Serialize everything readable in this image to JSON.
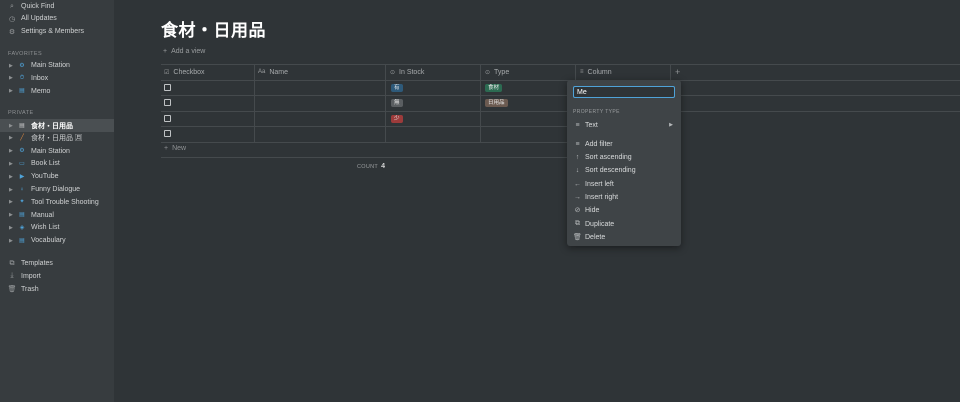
{
  "sidebar": {
    "top": [
      {
        "label": "Quick Find",
        "icon": "search-icon",
        "glyph": "⌕"
      },
      {
        "label": "All Updates",
        "icon": "clock-icon",
        "glyph": "◷"
      },
      {
        "label": "Settings & Members",
        "icon": "gear-icon",
        "glyph": "⚙"
      }
    ],
    "favorites_heading": "FAVORITES",
    "favorites": [
      {
        "label": "Main Station",
        "icon": "station-icon",
        "glyph": "⚙",
        "color": "#4fa3d9"
      },
      {
        "label": "Inbox",
        "icon": "inbox-icon",
        "glyph": "⏱",
        "color": "#4fa3d9"
      },
      {
        "label": "Memo",
        "icon": "memo-icon",
        "glyph": "▤",
        "color": "#4fa3d9"
      }
    ],
    "private_heading": "PRIVATE",
    "private": [
      {
        "label": "食材・日用品",
        "icon": "page-icon",
        "glyph": "▤",
        "color": "#c9cbcc",
        "active": true
      },
      {
        "label": "食材・日用品 🈷",
        "icon": "carrot-icon",
        "glyph": "╱",
        "color": "#e0893e"
      },
      {
        "label": "Main Station",
        "icon": "station-icon",
        "glyph": "⚙",
        "color": "#4fa3d9"
      },
      {
        "label": "Book List",
        "icon": "book-icon",
        "glyph": "▭",
        "color": "#4fa3d9"
      },
      {
        "label": "YouTube",
        "icon": "youtube-icon",
        "glyph": "▶",
        "color": "#4fa3d9"
      },
      {
        "label": "Funny Dialogue",
        "icon": "bulb-icon",
        "glyph": "♀",
        "color": "#4fa3d9"
      },
      {
        "label": "Tool Trouble Shooting",
        "icon": "tools-icon",
        "glyph": "✦",
        "color": "#4fa3d9"
      },
      {
        "label": "Manual",
        "icon": "manual-icon",
        "glyph": "▤",
        "color": "#4fa3d9"
      },
      {
        "label": "Wish List",
        "icon": "gift-icon",
        "glyph": "◈",
        "color": "#4fa3d9"
      },
      {
        "label": "Vocabulary",
        "icon": "vocabulary-icon",
        "glyph": "▤",
        "color": "#4fa3d9"
      }
    ],
    "bottom": [
      {
        "label": "Templates",
        "icon": "templates-icon",
        "glyph": "⧉"
      },
      {
        "label": "Import",
        "icon": "import-icon",
        "glyph": "⤓"
      },
      {
        "label": "Trash",
        "icon": "trash-icon",
        "glyph": "🗑"
      }
    ]
  },
  "page": {
    "title": "食材・日用品",
    "add_view": "Add a view",
    "new_row": "New",
    "count_label": "COUNT",
    "count_value": "4"
  },
  "table": {
    "columns": [
      {
        "label": "Checkbox",
        "icon": "checkbox-icon",
        "glyph": "☑"
      },
      {
        "label": "Name",
        "icon": "text-icon",
        "glyph": "Aa"
      },
      {
        "label": "In Stock",
        "icon": "select-icon",
        "glyph": "⊙"
      },
      {
        "label": "Type",
        "icon": "select-icon",
        "glyph": "⊙"
      },
      {
        "label": "Column",
        "icon": "text-lines-icon",
        "glyph": "≡"
      }
    ],
    "rows": [
      {
        "stock": "有",
        "stock_color": "#2e5a7a",
        "type": "食材",
        "type_color": "#2c6b52"
      },
      {
        "stock": "無",
        "stock_color": "#5a5e61",
        "type": "日用品",
        "type_color": "#6b5a50"
      },
      {
        "stock": "少",
        "stock_color": "#9c3b3b",
        "type": "",
        "type_color": ""
      },
      {
        "stock": "",
        "stock_color": "",
        "type": "",
        "type_color": ""
      }
    ]
  },
  "popup": {
    "input_value": "Me",
    "property_type_heading": "PROPERTY TYPE",
    "property_type": "Text",
    "items": [
      {
        "label": "Add filter",
        "icon": "filter-icon",
        "glyph": "≡"
      },
      {
        "label": "Sort ascending",
        "icon": "arrow-up-icon",
        "glyph": "↑"
      },
      {
        "label": "Sort descending",
        "icon": "arrow-down-icon",
        "glyph": "↓"
      },
      {
        "label": "Insert left",
        "icon": "arrow-left-icon",
        "glyph": "←"
      },
      {
        "label": "Insert right",
        "icon": "arrow-right-icon",
        "glyph": "→"
      },
      {
        "label": "Hide",
        "icon": "eye-off-icon",
        "glyph": "⊘"
      },
      {
        "label": "Duplicate",
        "icon": "duplicate-icon",
        "glyph": "⧉"
      },
      {
        "label": "Delete",
        "icon": "trash-icon",
        "glyph": "🗑"
      }
    ]
  },
  "colors": {
    "background": "#2f3437",
    "sidebar": "#373c3f",
    "accent": "#4fa3d9"
  }
}
